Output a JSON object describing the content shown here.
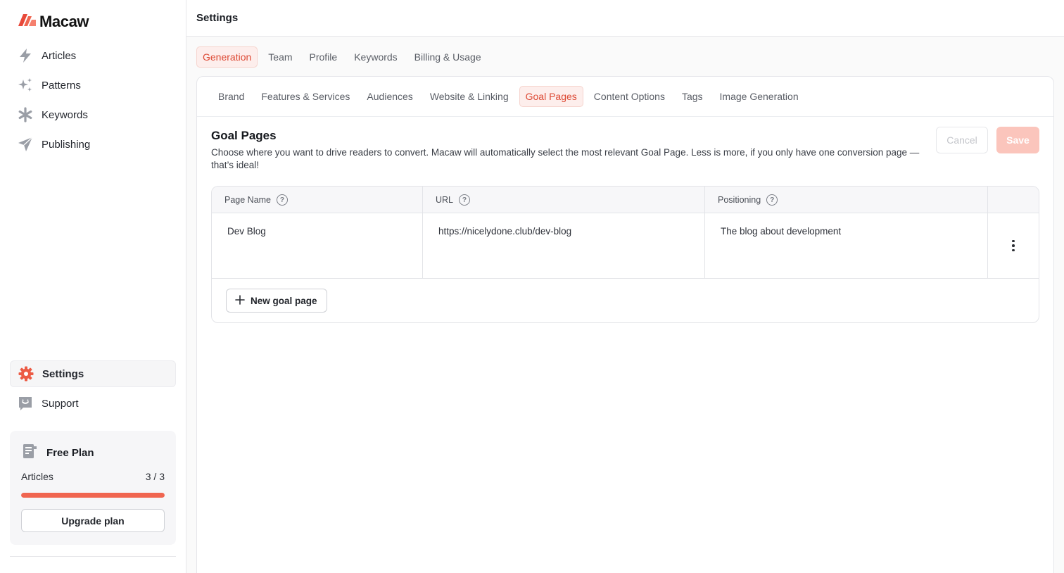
{
  "app": {
    "name": "Macaw"
  },
  "sidebar": {
    "items": [
      {
        "label": "Articles",
        "icon": "lightning-icon"
      },
      {
        "label": "Patterns",
        "icon": "sparkles-icon"
      },
      {
        "label": "Keywords",
        "icon": "asterisk-icon"
      },
      {
        "label": "Publishing",
        "icon": "send-icon"
      }
    ],
    "bottom_items": [
      {
        "label": "Settings",
        "icon": "gear-icon",
        "active": true
      },
      {
        "label": "Support",
        "icon": "support-icon"
      }
    ],
    "plan": {
      "title": "Free Plan",
      "metric_label": "Articles",
      "metric_value": "3 / 3",
      "usage_fraction": 1.0,
      "upgrade_label": "Upgrade plan"
    }
  },
  "header": {
    "title": "Settings"
  },
  "settings_tabs": [
    {
      "label": "Generation",
      "active": true
    },
    {
      "label": "Team"
    },
    {
      "label": "Profile"
    },
    {
      "label": "Keywords"
    },
    {
      "label": "Billing & Usage"
    }
  ],
  "generation_tabs": [
    {
      "label": "Brand"
    },
    {
      "label": "Features & Services"
    },
    {
      "label": "Audiences"
    },
    {
      "label": "Website & Linking"
    },
    {
      "label": "Goal Pages",
      "active": true
    },
    {
      "label": "Content Options"
    },
    {
      "label": "Tags"
    },
    {
      "label": "Image Generation"
    }
  ],
  "goal_pages": {
    "title": "Goal Pages",
    "description": "Choose where you want to drive readers to convert. Macaw will automatically select the most relevant Goal Page. Less is more, if you only have one conversion page —that’s ideal!",
    "cancel_label": "Cancel",
    "save_label": "Save",
    "columns": [
      "Page Name",
      "URL",
      "Positioning"
    ],
    "help_glyph": "?",
    "rows": [
      {
        "name": "Dev Blog",
        "url": "https://nicelydone.club/dev-blog",
        "positioning": "The blog about development"
      }
    ],
    "new_label": "New goal page"
  },
  "colors": {
    "accent": "#f06550",
    "active_tab_bg": "#fdeeec",
    "active_tab_text": "#dd4a35",
    "save_disabled": "#fbc5bc"
  }
}
